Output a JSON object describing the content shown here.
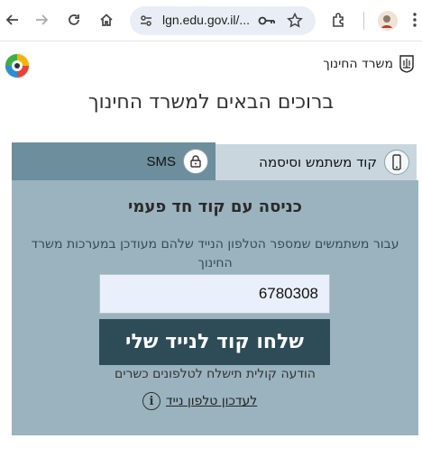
{
  "browser": {
    "url": "lgn.edu.gov.il/..."
  },
  "header": {
    "ministry_name": "משרד החינוך"
  },
  "welcome_title": "ברוכים הבאים למשרד החינוך",
  "tabs": {
    "user_password": "קוד משתמש וסיסמה",
    "sms": "SMS"
  },
  "login": {
    "title": "כניסה עם קוד חד פעמי",
    "description": "עבור משתמשים שמספר הטלפון הנייד שלהם מעודכן במערכות משרד החינוך",
    "phone_value": "6780308",
    "send_button": "שלחו קוד לנייד שלי",
    "voice_note": "הודעה קולית תישלח לטלפונים כשרים",
    "update_phone_link": "לעדכון טלפון נייד",
    "info_glyph": "i"
  },
  "colors": {
    "card_bg": "#9ab3bf",
    "active_tab": "#6d8e9d",
    "inactive_tab": "#c9d6dd",
    "button_bg": "#2e4c58"
  }
}
